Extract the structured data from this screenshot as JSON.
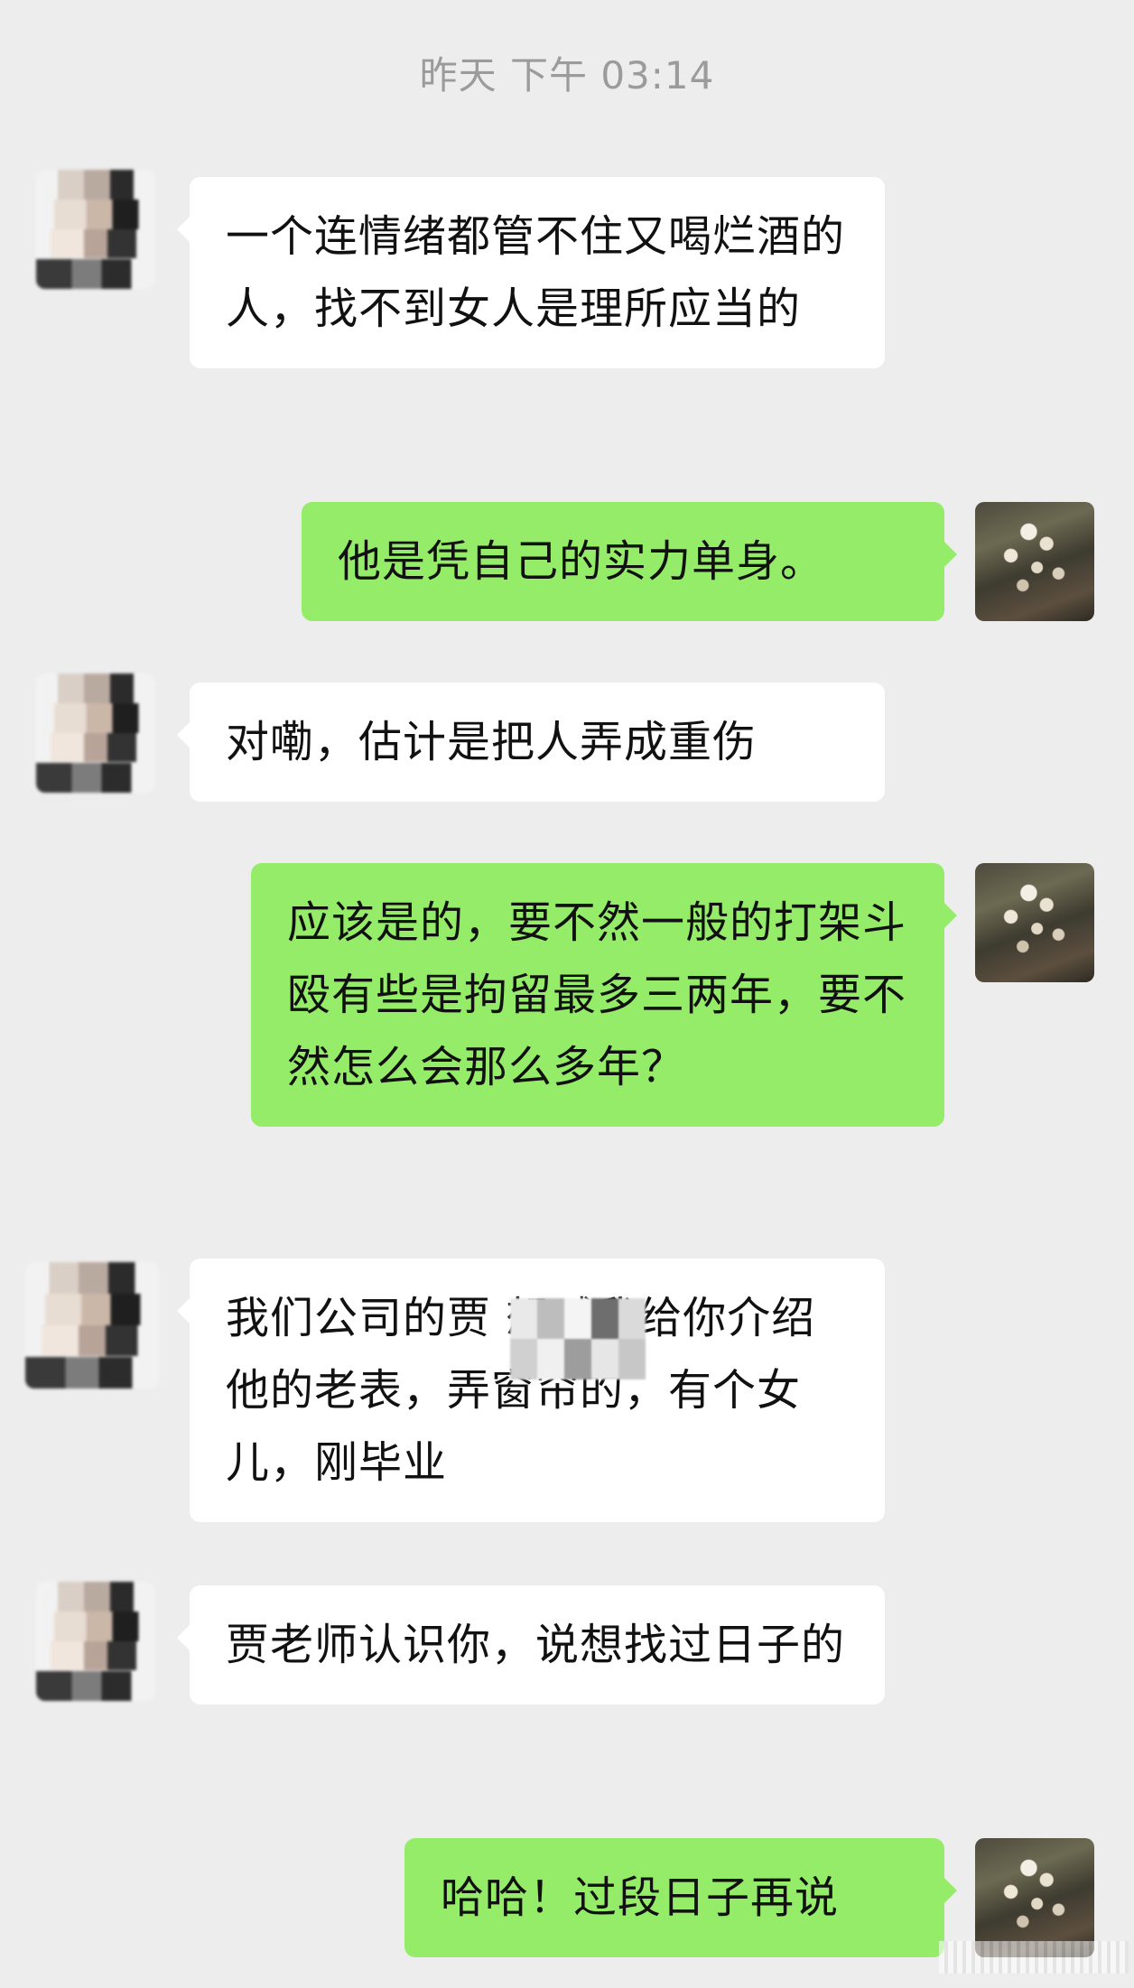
{
  "chat": {
    "timestamp": "昨天 下午 03:14",
    "messages": [
      {
        "side": "left",
        "avatar": "blurred-person-avatar",
        "text": "一个连情绪都管不住又喝烂酒的人，找不到女人是理所应当的"
      },
      {
        "side": "right",
        "avatar": "flower-sprout-avatar",
        "text": "他是凭自己的实力单身。"
      },
      {
        "side": "left",
        "avatar": "blurred-person-avatar",
        "text": "对嘞，估计是把人弄成重伤"
      },
      {
        "side": "right",
        "avatar": "flower-sprout-avatar",
        "text": "应该是的，要不然一般的打架斗殴有些是拘留最多三两年，要不然怎么会那么多年？"
      },
      {
        "side": "left",
        "avatar": "blurred-person-avatar",
        "text": "我们公司的贾     想喊我给你介绍他的老表，弄窗帘的，有个女儿，刚毕业"
      },
      {
        "side": "left",
        "avatar": "blurred-person-avatar",
        "text": "贾老师认识你，说想找过日子的"
      },
      {
        "side": "right",
        "avatar": "flower-sprout-avatar",
        "text": "哈哈！过段日子再说"
      }
    ]
  },
  "colors": {
    "background": "#ededed",
    "incoming_bubble": "#ffffff",
    "outgoing_bubble": "#95ec69",
    "timestamp_text": "#9b9b9b"
  }
}
